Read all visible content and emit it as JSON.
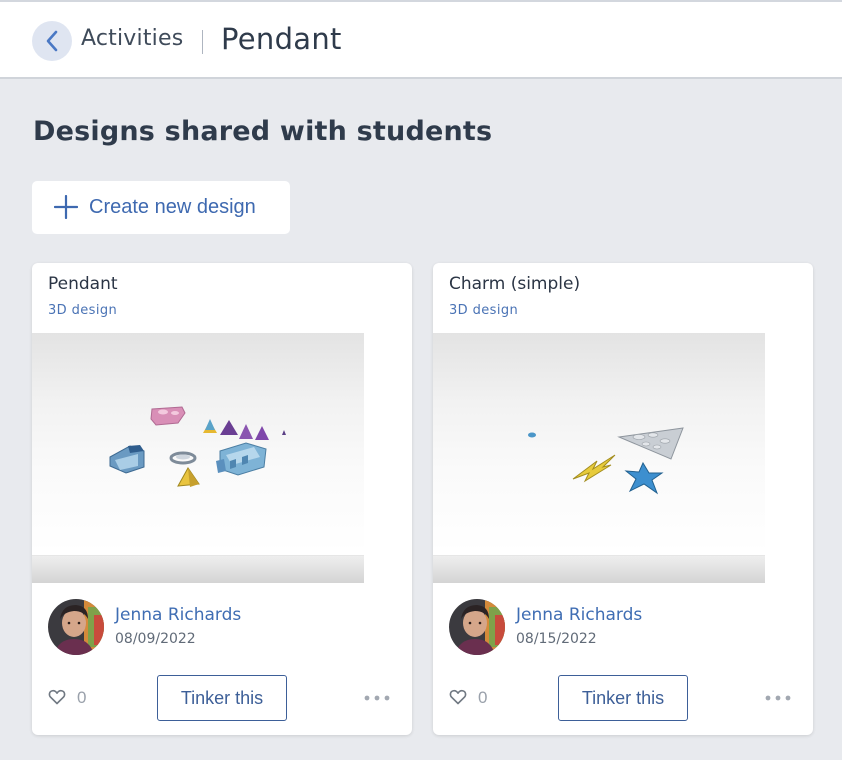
{
  "header": {
    "back_icon": "chevron-left-icon",
    "breadcrumb": "Activities",
    "title": "Pendant"
  },
  "main": {
    "heading": "Designs shared with students",
    "create_button": {
      "icon": "plus-icon",
      "label": "Create new design"
    }
  },
  "cards": [
    {
      "title": "Pendant",
      "type": "3D design",
      "thumbnail_icon": "design-thumbnail",
      "author": "Jenna Richards",
      "date": "08/09/2022",
      "likes": "0",
      "action": "Tinker this",
      "more_icon": "more-options-icon"
    },
    {
      "title": "Charm (simple)",
      "type": "3D design",
      "thumbnail_icon": "design-thumbnail",
      "author": "Jenna Richards",
      "date": "08/15/2022",
      "likes": "0",
      "action": "Tinker this",
      "more_icon": "more-options-icon"
    }
  ],
  "colors": {
    "accent": "#3f6db3",
    "background": "#e8eaee",
    "card": "#ffffff"
  }
}
